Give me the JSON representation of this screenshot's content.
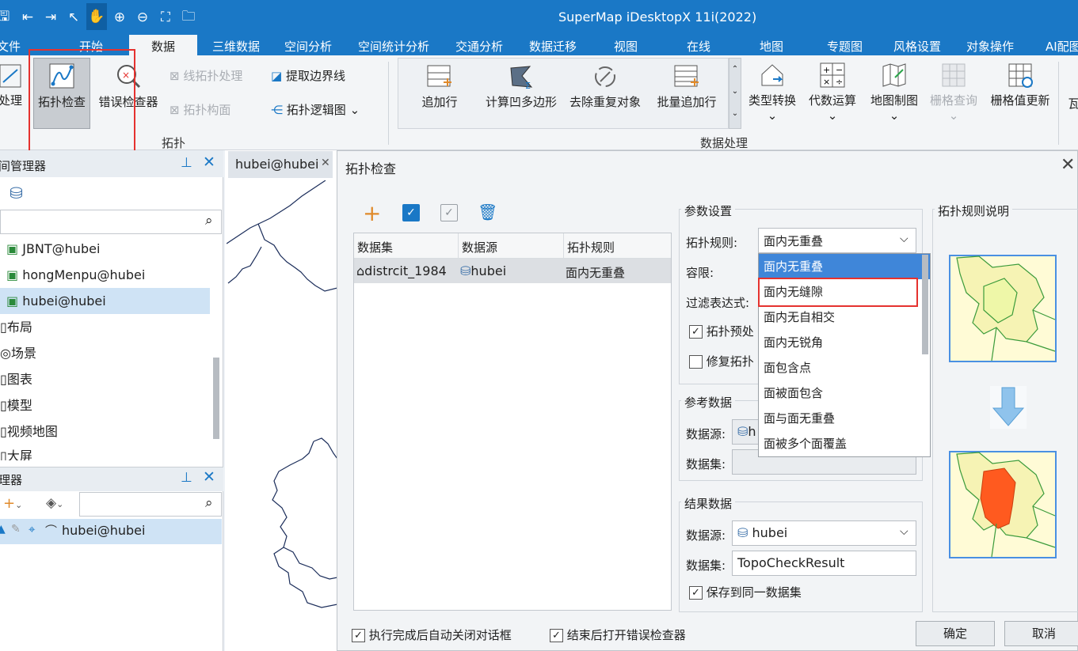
{
  "app": {
    "title": "SuperMap iDesktopX 11i(2022)"
  },
  "quick_access": [
    "save-icon",
    "undo-icon",
    "redo-icon",
    "pointer-icon",
    "pan-hand-icon",
    "zoom-in-icon",
    "zoom-out-icon",
    "full-extent-icon",
    "open-folder-icon"
  ],
  "tabs": [
    "文件",
    "开始",
    "数据",
    "三维数据",
    "空间分析",
    "空间统计分析",
    "交通分析",
    "数据迁移",
    "视图",
    "在线",
    "地图",
    "专题图",
    "风格设置",
    "对象操作",
    "AI配图"
  ],
  "ribbon": {
    "topo_group": {
      "partial_left": "处理",
      "topo_check": "拓扑检查",
      "error_checker": "错误检查器",
      "line_topo": "线拓扑处理",
      "topo_build": "拓扑构面",
      "extract_boundary": "提取边界线",
      "topo_logic_map": "拓扑逻辑图",
      "label": "拓扑"
    },
    "data_group": {
      "append_row": "追加行",
      "concave_polygon": "计算凹多边形",
      "remove_duplicate": "去除重复对象",
      "batch_append": "批量追加行",
      "label": "数据处理"
    },
    "right_tools": {
      "type_convert": "类型转换",
      "algebra": "代数运算",
      "map_cartography": "地图制图",
      "raster_query": "栅格查询",
      "raster_update": "栅格值更新",
      "partial_right": "瓦"
    }
  },
  "workspace_panel": {
    "title": "间管理器",
    "items": [
      "JBNT@hubei",
      "hongMenpu@hubei",
      "hubei@hubei",
      "布局",
      "场景",
      "图表",
      "模型",
      "视频地图",
      "大屏"
    ]
  },
  "layer_panel": {
    "title": "理器",
    "layer": "hubei@hubei"
  },
  "map_tab": {
    "label": "hubei@hubei"
  },
  "dialog": {
    "title": "拓扑检查",
    "table": {
      "headers": [
        "数据集",
        "数据源",
        "拓扑规则"
      ],
      "rows": [
        {
          "dataset": "distrcit_1984",
          "source": "hubei",
          "rule": "面内无重叠"
        }
      ]
    },
    "params": {
      "group": "参数设置",
      "rule_label": "拓扑规则:",
      "rule_value": "面内无重叠",
      "tolerance_label": "容限:",
      "filter_label": "过滤表达式:",
      "preprocess_label": "拓扑预处",
      "repair_label": "修复拓扑"
    },
    "dropdown": [
      "面内无重叠",
      "面内无缝隙",
      "面内无自相交",
      "面内无锐角",
      "面包含点",
      "面被面包含",
      "面与面无重叠",
      "面被多个面覆盖"
    ],
    "reference": {
      "group": "参考数据",
      "source_label": "数据源:",
      "source_partial": "h",
      "dataset_label": "数据集:"
    },
    "result": {
      "group": "结果数据",
      "source_label": "数据源:",
      "source_value": "hubei",
      "dataset_label": "数据集:",
      "dataset_value": "TopoCheckResult",
      "save_same_label": "保存到同一数据集"
    },
    "rule_desc": {
      "title": "拓扑规则说明"
    },
    "footer": {
      "auto_close_label": "执行完成后自动关闭对话框",
      "open_checker_label": "结束后打开错误检查器",
      "ok": "确定",
      "cancel": "取消"
    }
  },
  "colors": {
    "brand": "#1a78c6",
    "highlight": "#3f86d9",
    "selection": "#cfe3f5",
    "annotation_red": "#e5322f",
    "error_fill": "#ff5a1f"
  }
}
